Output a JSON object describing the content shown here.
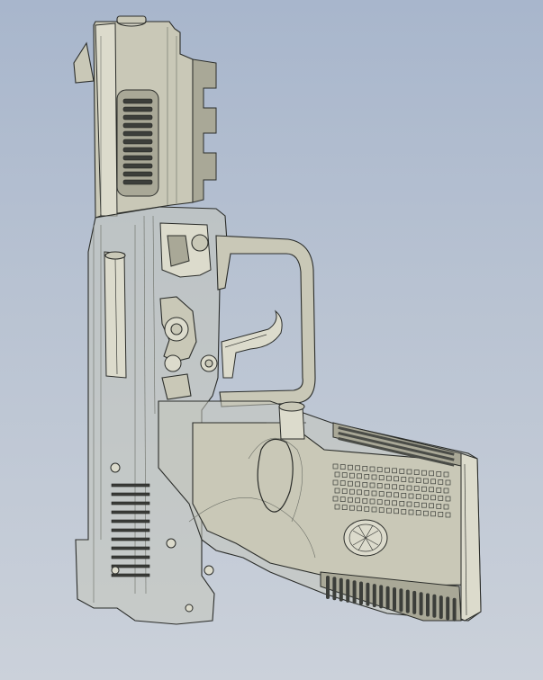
{
  "scene": {
    "subject": "pistol-cad-wireframe",
    "colors": {
      "background_top": "#a8b6cc",
      "background_bottom": "#cbd1da",
      "metal": "#c9c8b7",
      "outline": "#2b2d2a",
      "texture": "#3c3e3a"
    }
  }
}
